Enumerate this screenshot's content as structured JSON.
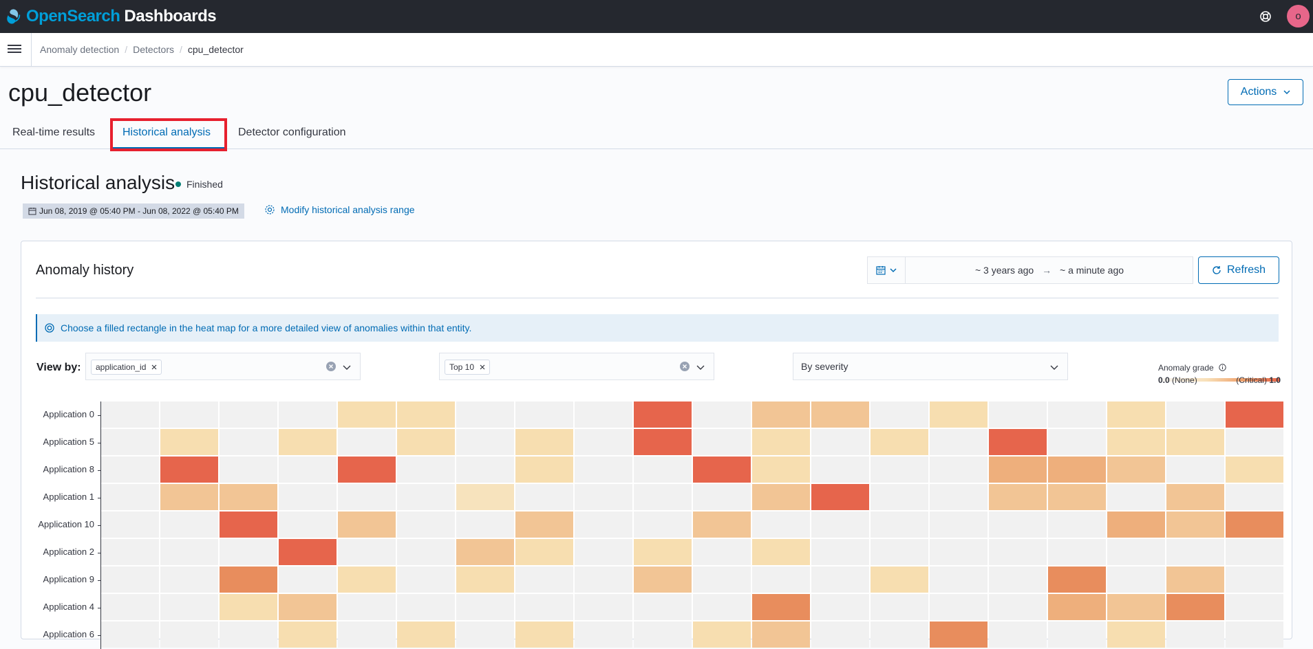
{
  "app": {
    "logo_open": "Open",
    "logo_search": "Search",
    "logo_dashboards": "Dashboards",
    "avatar_initial": "o"
  },
  "breadcrumbs": [
    "Anomaly detection",
    "Detectors",
    "cpu_detector"
  ],
  "page": {
    "title": "cpu_detector",
    "actions_label": "Actions"
  },
  "tabs": [
    {
      "label": "Real-time results",
      "active": false
    },
    {
      "label": "Historical analysis",
      "active": true
    },
    {
      "label": "Detector configuration",
      "active": false
    }
  ],
  "historical": {
    "title": "Historical analysis",
    "status": "Finished",
    "range": "Jun 08, 2019 @ 05:40 PM - Jun 08, 2022 @ 05:40 PM",
    "modify_link": "Modify historical analysis range"
  },
  "anomaly_history": {
    "title": "Anomaly history",
    "date_start": "~ 3 years ago",
    "date_end": "~ a minute ago",
    "refresh_label": "Refresh",
    "callout": "Choose a filled rectangle in the heat map for a more detailed view of anomalies within that entity.",
    "view_by_label": "View by:",
    "view_by_value": "application_id",
    "top_value": "Top 10",
    "sort_value": "By severity",
    "legend": {
      "title": "Anomaly grade",
      "low_value": "0.0",
      "low_label": "(None)",
      "high_label": "(Critical)",
      "high_value": "1.0"
    }
  },
  "chart_data": {
    "type": "heatmap",
    "title": "",
    "y_categories": [
      "Application 0",
      "Application 5",
      "Application 8",
      "Application 1",
      "Application 10",
      "Application 2",
      "Application 9",
      "Application 4",
      "Application 6"
    ],
    "columns": 20,
    "grades": [
      [
        0,
        0,
        0,
        0,
        0.2,
        0.2,
        0,
        0,
        0,
        0.9,
        0,
        0.35,
        0.35,
        0,
        0.2,
        0,
        0,
        0.2,
        0,
        0.9
      ],
      [
        0,
        0.2,
        0,
        0.2,
        0,
        0.2,
        0,
        0.2,
        0,
        0.9,
        0,
        0.2,
        0,
        0.2,
        0,
        0.9,
        0,
        0.2,
        0.2,
        0
      ],
      [
        0,
        0.9,
        0,
        0,
        0.9,
        0,
        0,
        0.2,
        0,
        0,
        0.9,
        0.2,
        0,
        0,
        0,
        0.45,
        0.45,
        0.35,
        0,
        0.2
      ],
      [
        0,
        0.35,
        0.35,
        0,
        0,
        0,
        0.15,
        0,
        0,
        0,
        0,
        0.35,
        0.9,
        0,
        0,
        0.35,
        0.35,
        0,
        0.35,
        0
      ],
      [
        0,
        0,
        0.9,
        0,
        0.35,
        0,
        0,
        0.35,
        0,
        0,
        0.35,
        0,
        0,
        0,
        0,
        0,
        0,
        0.45,
        0.35,
        0.6
      ],
      [
        0,
        0,
        0,
        0.9,
        0,
        0,
        0.35,
        0.2,
        0,
        0.2,
        0,
        0.2,
        0,
        0,
        0,
        0,
        0,
        0,
        0,
        0
      ],
      [
        0,
        0,
        0.6,
        0,
        0.2,
        0,
        0.2,
        0,
        0,
        0.35,
        0,
        0,
        0,
        0.2,
        0,
        0,
        0.6,
        0,
        0.35,
        0
      ],
      [
        0,
        0,
        0.2,
        0.35,
        0,
        0,
        0,
        0,
        0,
        0,
        0,
        0.6,
        0,
        0,
        0,
        0,
        0.45,
        0.35,
        0.6,
        0
      ],
      [
        0,
        0,
        0,
        0.2,
        0,
        0.2,
        0,
        0.2,
        0,
        0,
        0.2,
        0.35,
        0,
        0,
        0.6,
        0,
        0,
        0.2,
        0,
        0
      ]
    ],
    "color_scale": {
      "0": "#f1f1f1",
      "0.15": "#f7e3bd",
      "0.2": "#f7deb0",
      "0.35": "#f2c595",
      "0.45": "#eeaf7c",
      "0.6": "#e88d5d",
      "0.9": "#e6654c"
    }
  }
}
